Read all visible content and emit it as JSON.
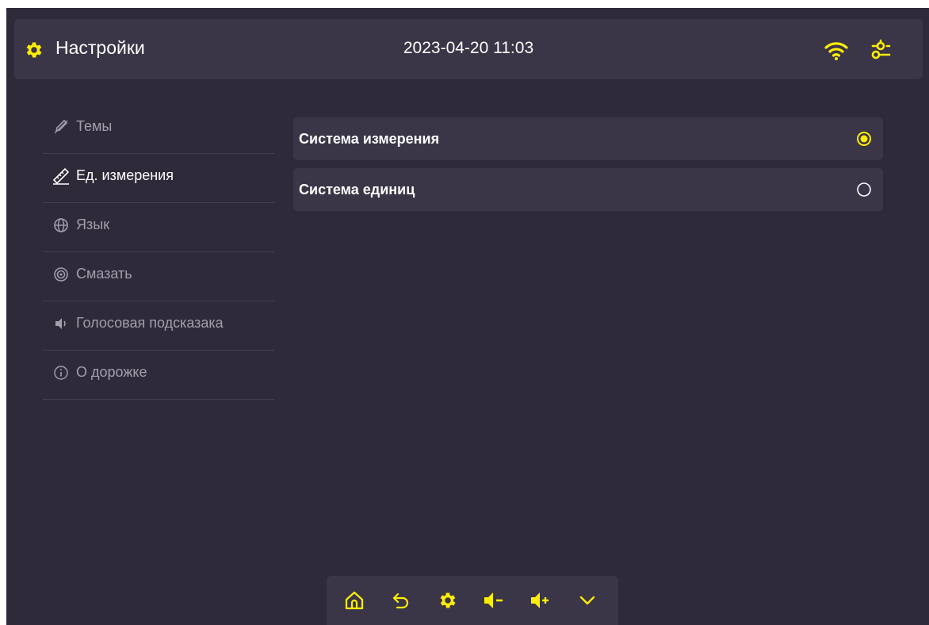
{
  "header": {
    "title": "Настройки",
    "datetime": "2023-04-20 11:03",
    "icons": [
      "gear-icon",
      "wifi-icon",
      "tune-icon"
    ]
  },
  "sidebar": {
    "items": [
      {
        "label": "Темы",
        "icon": "theme-icon",
        "active": false
      },
      {
        "label": "Ед. измерения",
        "icon": "ruler-icon",
        "active": true
      },
      {
        "label": "Язык",
        "icon": "globe-icon",
        "active": false
      },
      {
        "label": "Смазать",
        "icon": "lubricate-icon",
        "active": false
      },
      {
        "label": "Голосовая подсказака",
        "icon": "speaker-icon",
        "active": false
      },
      {
        "label": "О дорожке",
        "icon": "info-icon",
        "active": false
      }
    ]
  },
  "main": {
    "options": [
      {
        "label": "Система измерения",
        "selected": true
      },
      {
        "label": "Система единиц",
        "selected": false
      }
    ]
  },
  "bottombar": {
    "buttons": [
      "home-icon",
      "back-icon",
      "settings-icon",
      "volume-down-icon",
      "volume-up-icon",
      "collapse-icon"
    ]
  },
  "colors": {
    "accent": "#ffee00",
    "background": "#2f2a3a",
    "panel": "#3a3547",
    "text_muted": "#a29fad"
  }
}
